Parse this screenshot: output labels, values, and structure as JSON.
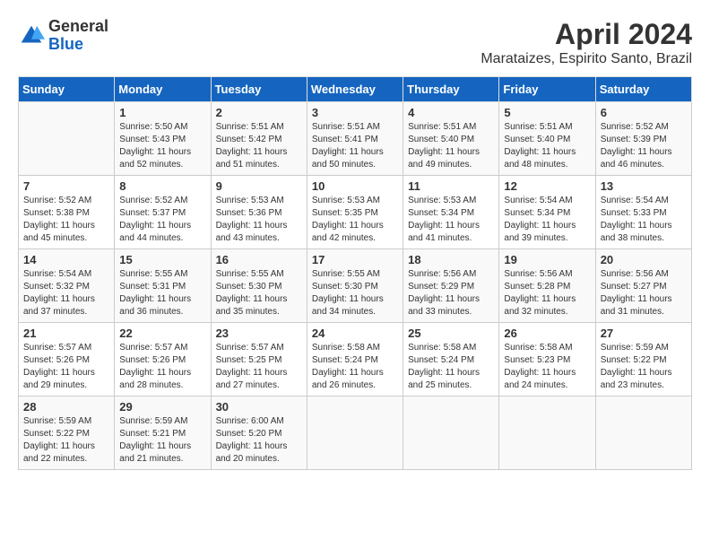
{
  "header": {
    "logo_general": "General",
    "logo_blue": "Blue",
    "title": "April 2024",
    "subtitle": "Marataizes, Espirito Santo, Brazil"
  },
  "days_of_week": [
    "Sunday",
    "Monday",
    "Tuesday",
    "Wednesday",
    "Thursday",
    "Friday",
    "Saturday"
  ],
  "weeks": [
    [
      {
        "day": "",
        "info": ""
      },
      {
        "day": "1",
        "info": "Sunrise: 5:50 AM\nSunset: 5:43 PM\nDaylight: 11 hours\nand 52 minutes."
      },
      {
        "day": "2",
        "info": "Sunrise: 5:51 AM\nSunset: 5:42 PM\nDaylight: 11 hours\nand 51 minutes."
      },
      {
        "day": "3",
        "info": "Sunrise: 5:51 AM\nSunset: 5:41 PM\nDaylight: 11 hours\nand 50 minutes."
      },
      {
        "day": "4",
        "info": "Sunrise: 5:51 AM\nSunset: 5:40 PM\nDaylight: 11 hours\nand 49 minutes."
      },
      {
        "day": "5",
        "info": "Sunrise: 5:51 AM\nSunset: 5:40 PM\nDaylight: 11 hours\nand 48 minutes."
      },
      {
        "day": "6",
        "info": "Sunrise: 5:52 AM\nSunset: 5:39 PM\nDaylight: 11 hours\nand 46 minutes."
      }
    ],
    [
      {
        "day": "7",
        "info": "Sunrise: 5:52 AM\nSunset: 5:38 PM\nDaylight: 11 hours\nand 45 minutes."
      },
      {
        "day": "8",
        "info": "Sunrise: 5:52 AM\nSunset: 5:37 PM\nDaylight: 11 hours\nand 44 minutes."
      },
      {
        "day": "9",
        "info": "Sunrise: 5:53 AM\nSunset: 5:36 PM\nDaylight: 11 hours\nand 43 minutes."
      },
      {
        "day": "10",
        "info": "Sunrise: 5:53 AM\nSunset: 5:35 PM\nDaylight: 11 hours\nand 42 minutes."
      },
      {
        "day": "11",
        "info": "Sunrise: 5:53 AM\nSunset: 5:34 PM\nDaylight: 11 hours\nand 41 minutes."
      },
      {
        "day": "12",
        "info": "Sunrise: 5:54 AM\nSunset: 5:34 PM\nDaylight: 11 hours\nand 39 minutes."
      },
      {
        "day": "13",
        "info": "Sunrise: 5:54 AM\nSunset: 5:33 PM\nDaylight: 11 hours\nand 38 minutes."
      }
    ],
    [
      {
        "day": "14",
        "info": "Sunrise: 5:54 AM\nSunset: 5:32 PM\nDaylight: 11 hours\nand 37 minutes."
      },
      {
        "day": "15",
        "info": "Sunrise: 5:55 AM\nSunset: 5:31 PM\nDaylight: 11 hours\nand 36 minutes."
      },
      {
        "day": "16",
        "info": "Sunrise: 5:55 AM\nSunset: 5:30 PM\nDaylight: 11 hours\nand 35 minutes."
      },
      {
        "day": "17",
        "info": "Sunrise: 5:55 AM\nSunset: 5:30 PM\nDaylight: 11 hours\nand 34 minutes."
      },
      {
        "day": "18",
        "info": "Sunrise: 5:56 AM\nSunset: 5:29 PM\nDaylight: 11 hours\nand 33 minutes."
      },
      {
        "day": "19",
        "info": "Sunrise: 5:56 AM\nSunset: 5:28 PM\nDaylight: 11 hours\nand 32 minutes."
      },
      {
        "day": "20",
        "info": "Sunrise: 5:56 AM\nSunset: 5:27 PM\nDaylight: 11 hours\nand 31 minutes."
      }
    ],
    [
      {
        "day": "21",
        "info": "Sunrise: 5:57 AM\nSunset: 5:26 PM\nDaylight: 11 hours\nand 29 minutes."
      },
      {
        "day": "22",
        "info": "Sunrise: 5:57 AM\nSunset: 5:26 PM\nDaylight: 11 hours\nand 28 minutes."
      },
      {
        "day": "23",
        "info": "Sunrise: 5:57 AM\nSunset: 5:25 PM\nDaylight: 11 hours\nand 27 minutes."
      },
      {
        "day": "24",
        "info": "Sunrise: 5:58 AM\nSunset: 5:24 PM\nDaylight: 11 hours\nand 26 minutes."
      },
      {
        "day": "25",
        "info": "Sunrise: 5:58 AM\nSunset: 5:24 PM\nDaylight: 11 hours\nand 25 minutes."
      },
      {
        "day": "26",
        "info": "Sunrise: 5:58 AM\nSunset: 5:23 PM\nDaylight: 11 hours\nand 24 minutes."
      },
      {
        "day": "27",
        "info": "Sunrise: 5:59 AM\nSunset: 5:22 PM\nDaylight: 11 hours\nand 23 minutes."
      }
    ],
    [
      {
        "day": "28",
        "info": "Sunrise: 5:59 AM\nSunset: 5:22 PM\nDaylight: 11 hours\nand 22 minutes."
      },
      {
        "day": "29",
        "info": "Sunrise: 5:59 AM\nSunset: 5:21 PM\nDaylight: 11 hours\nand 21 minutes."
      },
      {
        "day": "30",
        "info": "Sunrise: 6:00 AM\nSunset: 5:20 PM\nDaylight: 11 hours\nand 20 minutes."
      },
      {
        "day": "",
        "info": ""
      },
      {
        "day": "",
        "info": ""
      },
      {
        "day": "",
        "info": ""
      },
      {
        "day": "",
        "info": ""
      }
    ]
  ]
}
